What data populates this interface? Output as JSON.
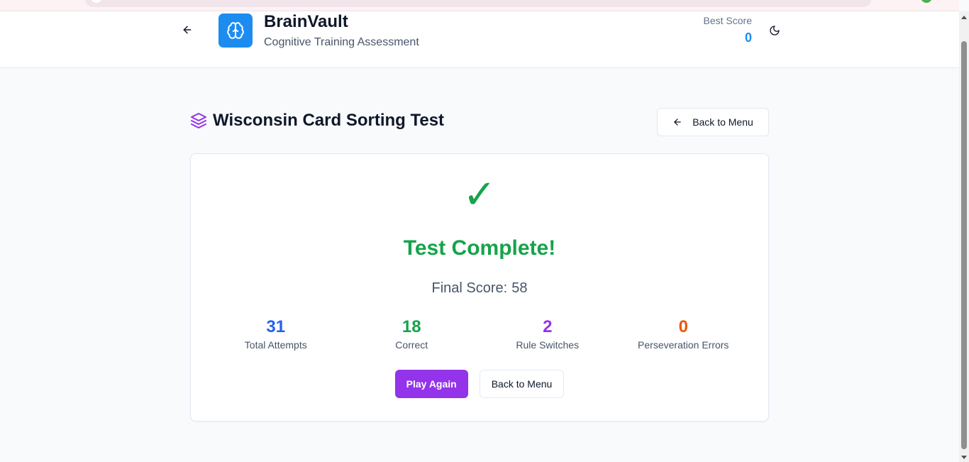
{
  "header": {
    "brand_title": "BrainVault",
    "brand_subtitle": "Cognitive Training Assessment",
    "best_score_label": "Best Score",
    "best_score_value": "0"
  },
  "test": {
    "title": "Wisconsin Card Sorting Test",
    "back_to_menu_label": "Back to Menu"
  },
  "result": {
    "check_glyph": "✓",
    "title": "Test Complete!",
    "final_score_label": "Final Score:",
    "final_score_value": "58",
    "stats": [
      {
        "value": "31",
        "label": "Total Attempts",
        "color": "#2563eb"
      },
      {
        "value": "18",
        "label": "Correct",
        "color": "#16a34a"
      },
      {
        "value": "2",
        "label": "Rule Switches",
        "color": "#9333ea"
      },
      {
        "value": "0",
        "label": "Perseveration Errors",
        "color": "#ea580c"
      }
    ],
    "play_again_label": "Play Again",
    "back_to_menu_label": "Back to Menu"
  },
  "colors": {
    "brand": "#1d8cf0",
    "success": "#16a34a",
    "accent": "#9333ea"
  },
  "icons": {
    "back": "arrow-left-icon",
    "logo": "brain-icon",
    "theme": "moon-icon",
    "test": "layers-icon"
  }
}
